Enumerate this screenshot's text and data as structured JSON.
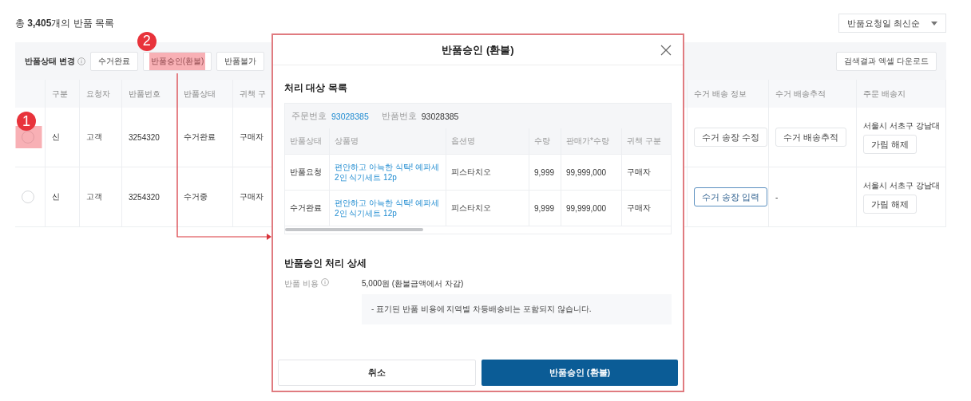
{
  "heading": "총 **3,405**개의 반품 목록",
  "sort_dropdown": {
    "value": "반품요청일 최신순"
  },
  "toolbar": {
    "label": "반품상태 변경",
    "buttons": [
      {
        "label": "수거완료"
      },
      {
        "label": "반품승인(환불)",
        "annotation": "2"
      },
      {
        "label": "반품불가"
      }
    ],
    "download_button": "검색결과 엑셀 다운로드"
  },
  "table": {
    "columns_left": [
      "구분",
      "요청자",
      "반품번호",
      "반품상태",
      "귀책 구"
    ],
    "columns_right": [
      "수거 배송 정보",
      "수거 배송추적",
      "주문 배송지"
    ],
    "rows": [
      {
        "selected": false,
        "annotation": "1",
        "cells": [
          "신",
          "고객",
          "3254320",
          "수거완료",
          "구매자"
        ],
        "pickup_info": {
          "label": "수거 송장 수정",
          "kind": "default"
        },
        "tracking": {
          "kind": "button",
          "text": "수거 배송추적"
        },
        "address": "서울시 서초구 강남대",
        "address_button": "가림 해제"
      },
      {
        "selected": false,
        "cells": [
          "신",
          "고객",
          "3254320",
          "수거중",
          "구매자"
        ],
        "pickup_info": {
          "label": "수거 송장 입력",
          "kind": "primary"
        },
        "tracking": {
          "kind": "text",
          "text": "-"
        },
        "address": "서울시 서초구 강남대",
        "address_button": "가림 해제"
      }
    ]
  },
  "modal": {
    "title": "반품승인 (환불)",
    "targets": {
      "title": "처리 대상 목록",
      "order_label": "주문번호",
      "order_number": "93028385",
      "return_label": "반품번호",
      "return_number": "93028385",
      "columns": [
        "반품상태",
        "상품명",
        "옵션명",
        "수량",
        "판매가*수량",
        "귀책 구분"
      ],
      "rows": [
        {
          "status": "반품요청",
          "product": "편안하고 아늑한 식탁! 예파세 2인 식기세트 12p",
          "option": "피스타치오",
          "qty": "9,999",
          "total": "99,999,000",
          "fault": "구매자"
        },
        {
          "status": "수거완료",
          "product": "편안하고 아늑한 식탁! 예파세 2인 식기세트 12p",
          "option": "피스타치오",
          "qty": "9,999",
          "total": "99,999,000",
          "fault": "구매자"
        }
      ]
    },
    "details": {
      "title": "반품승인 처리 상세",
      "fee_label": "반품 비용",
      "fee_value": "5,000원 (환불금액에서 차감)",
      "notice": "- 표기된 반품 비용에 지역별 차등배송비는 포함되지 않습니다."
    },
    "cancel_button": "취소",
    "confirm_button": "반품승인 (환불)"
  }
}
